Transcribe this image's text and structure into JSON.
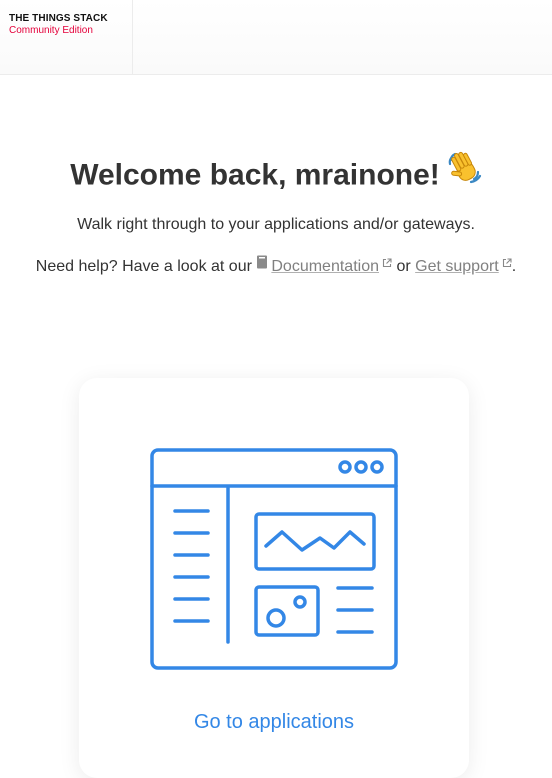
{
  "header": {
    "brand_title": "THE THINGS STACK",
    "brand_subtitle": "Community Edition"
  },
  "welcome": {
    "heading": "Welcome back, mrainone!",
    "emoji_icon": "waving-hand-icon",
    "subline": "Walk right through to your applications and/or gateways."
  },
  "help": {
    "prefix": "Need help? Have a look at our",
    "documentation_label": "Documentation",
    "middle": "or",
    "support_label": "Get support",
    "suffix": "."
  },
  "card": {
    "label": "Go to applications",
    "illustration_icon": "application-dashboard-icon"
  },
  "colors": {
    "brand_red": "#e4003a",
    "accent_blue": "#3387e6",
    "text": "#333333",
    "link_grey": "#808080"
  }
}
